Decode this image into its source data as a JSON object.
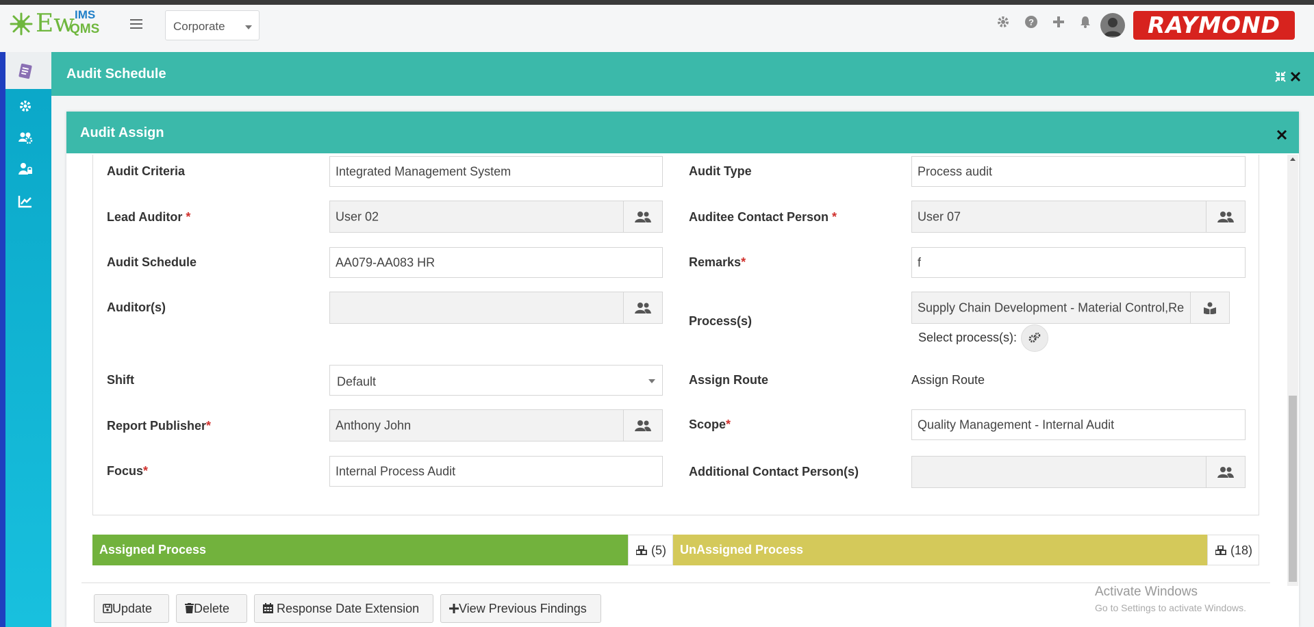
{
  "app": {
    "logo_main": "Ew",
    "logo_top": "IMS",
    "logo_bottom": "QMS",
    "company_select": "Corporate",
    "brand_text": "RAYMOND",
    "brand_color": "#d7231e",
    "accent_color": "#3bb9aa",
    "topbar_icons": [
      "gear-icon",
      "help-icon",
      "plus-icon",
      "bell-icon",
      "user-avatar-icon"
    ]
  },
  "sidebar": {
    "items": [
      "document-icon",
      "settings-icon",
      "users-gear-icon",
      "user-lock-icon",
      "chart-icon"
    ]
  },
  "panel": {
    "title": "Audit Schedule"
  },
  "modal": {
    "title": "Audit Assign"
  },
  "form": {
    "audit_criteria": {
      "label": "Audit Criteria",
      "value": "Integrated Management System"
    },
    "audit_type": {
      "label": "Audit Type",
      "value": "Process audit"
    },
    "lead_auditor": {
      "label": "Lead Auditor",
      "value": "User 02"
    },
    "auditee_contact": {
      "label": "Auditee Contact Person",
      "value": "User 07"
    },
    "audit_schedule": {
      "label": "Audit Schedule",
      "value": "AA079-AA083 HR"
    },
    "remarks": {
      "label": "Remarks",
      "value": "f"
    },
    "auditors": {
      "label": "Auditor(s)",
      "value": ""
    },
    "processes": {
      "label": "Process(s)",
      "value": "Supply Chain Development - Material Control,Re",
      "select_label": "Select process(s):"
    },
    "shift": {
      "label": "Shift",
      "value": "Default"
    },
    "assign_route": {
      "label": "Assign Route",
      "value": "Assign Route"
    },
    "report_publisher": {
      "label": "Report Publisher",
      "value": "Anthony John"
    },
    "scope": {
      "label": "Scope",
      "value": "Quality Management - Internal Audit"
    },
    "focus": {
      "label": "Focus",
      "value": "Internal Process Audit"
    },
    "additional_contact": {
      "label": "Additional Contact Person(s)",
      "value": ""
    },
    "required_mark": "*"
  },
  "process_bars": {
    "assigned": {
      "label": "Assigned Process",
      "count": "(5)",
      "color": "#72b23d"
    },
    "unassigned": {
      "label": "UnAssigned Process",
      "count": "(18)",
      "color": "#d4c95a"
    }
  },
  "buttons": {
    "update": "Update",
    "delete": "Delete",
    "response_date_extension": "Response Date Extension",
    "view_previous_findings": "View Previous Findings"
  },
  "watermark": {
    "line1": "Activate Windows",
    "line2": "Go to Settings to activate Windows."
  }
}
